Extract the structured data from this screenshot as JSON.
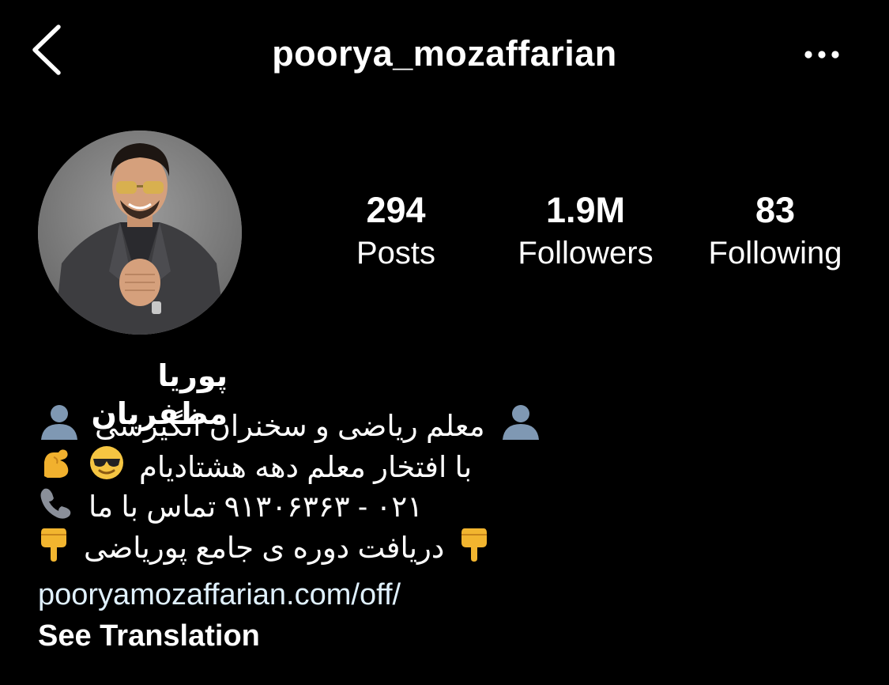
{
  "header": {
    "username": "poorya_mozaffarian",
    "back_icon": "chevron-left-icon",
    "more_icon": "more-horizontal-icon"
  },
  "stats": {
    "posts": {
      "value": "294",
      "label": "Posts"
    },
    "followers": {
      "value": "1.9M",
      "label": "Followers"
    },
    "following": {
      "value": "83",
      "label": "Following"
    }
  },
  "bio": {
    "full_name": "پوریا مظفریان",
    "lines": [
      {
        "text": "معلم ریاضی و سخنران انگیزشی",
        "icons": [
          "person-silhouette-icon",
          "person-silhouette-icon"
        ]
      },
      {
        "text": "با افتخار معلم دهه هشتادیام",
        "icons": [
          "flexed-biceps-icon",
          "sunglasses-face-icon"
        ]
      },
      {
        "text": "۰۲۱ - ۹۱۳۰۶۳۶۳ تماس با ما",
        "icons": [
          "telephone-receiver-icon"
        ]
      },
      {
        "text": "دریافت دوره ی جامع پوریاضی",
        "icons": [
          "pointing-down-icon",
          "pointing-down-icon"
        ]
      }
    ],
    "link": "pooryamozaffarian.com/off/",
    "see_translation": "See Translation"
  },
  "colors": {
    "background": "#000000",
    "text": "#ffffff",
    "link": "#e0f1ff"
  }
}
